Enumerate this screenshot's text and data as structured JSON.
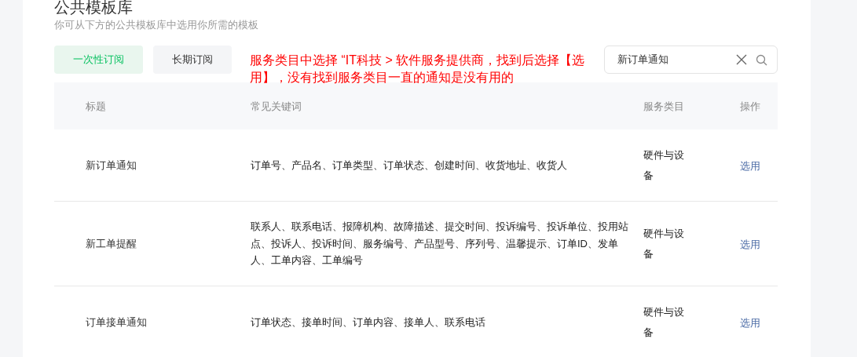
{
  "page": {
    "title": "公共模板库",
    "subtitle": "你可从下方的公共模板库中选用你所需的模板"
  },
  "tabs": [
    {
      "label": "一次性订阅",
      "selected": true
    },
    {
      "label": "长期订阅",
      "selected": false
    }
  ],
  "search": {
    "value": "新订单通知"
  },
  "table": {
    "columns": [
      "标题",
      "常见关键词",
      "服务类目",
      "操作"
    ],
    "rows": [
      {
        "title": "新订单通知",
        "keywords": "订单号、产品名、订单类型、订单状态、创建时间、收货地址、收货人",
        "category": "硬件与设备",
        "action": "选用"
      },
      {
        "title": "新工单提醒",
        "keywords": "联系人、联系电话、报障机构、故障描述、提交时间、投诉编号、投诉单位、投用站点、投诉人、投诉时间、服务编号、产品型号、序列号、温馨提示、订单ID、发单人、工单内容、工单编号",
        "category": "硬件与设备",
        "action": "选用"
      },
      {
        "title": "订单接单通知",
        "keywords": "订单状态、接单时间、订单内容、接单人、联系电话",
        "category": "硬件与设备",
        "action": "选用"
      }
    ]
  },
  "annotation": "服务类目中选择 “IT科技 > 软件服务提供商，找到后选择【选用】，没有找到服务类目一直的通知是没有用的"
}
